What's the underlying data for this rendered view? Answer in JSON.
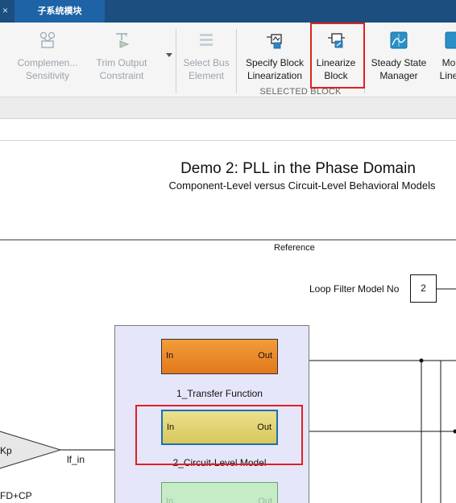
{
  "tabs": {
    "close_glyph": "×",
    "active_tab": "子系统模块"
  },
  "ribbon": {
    "buttons": [
      {
        "label": "Complemen...\nSensitivity",
        "icon": "complementary-sensitivity-icon",
        "enabled": false
      },
      {
        "label": "Trim Output\nConstraint",
        "icon": "trim-output-constraint-icon",
        "enabled": false
      },
      {
        "label": "Select Bus\nElement",
        "icon": "select-bus-element-icon",
        "enabled": false
      },
      {
        "label": "Specify Block\nLinearization",
        "icon": "specify-block-linearization-icon",
        "enabled": true
      },
      {
        "label": "Linearize\nBlock",
        "icon": "linearize-block-icon",
        "enabled": true
      },
      {
        "label": "Steady State\nManager",
        "icon": "steady-state-manager-icon",
        "enabled": true
      },
      {
        "label": "Mo\nLine",
        "icon": "model-linearizer-icon",
        "enabled": true
      }
    ],
    "group_label": "SELECTED BLOCK"
  },
  "canvas": {
    "title": "Demo 2: PLL in the Phase Domain",
    "subtitle": "Component-Level versus Circuit-Level Behavioral Models",
    "reference_label": "Reference",
    "loop_filter_label": "Loop Filter Model No",
    "loop_filter_value": "2",
    "blocks": [
      {
        "in": "In",
        "out": "Out",
        "name": "1_Transfer Function"
      },
      {
        "in": "In",
        "out": "Out",
        "name": "2_Circuit-Level Model"
      },
      {
        "in": "In",
        "out": "Out"
      }
    ],
    "gain_label": "Kp",
    "signal_label": "lf_in",
    "pfd_label": "FD+CP"
  },
  "colors": {
    "tabbar": "#1c4e80",
    "active_tab": "#1d63a6",
    "highlight": "#e02020",
    "orange_block": "#f39c3a",
    "yellow_block": "#e6d878",
    "green_block": "#c5ecc7",
    "subsystem_bg": "#e6e6fb"
  }
}
